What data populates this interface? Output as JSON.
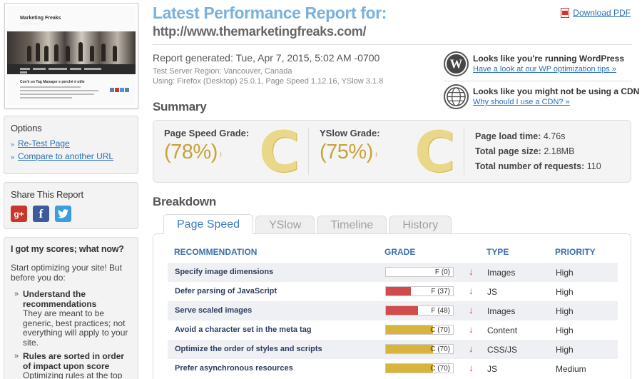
{
  "thumbnail": {
    "site_title": "Marketing Freaks",
    "post_title": "Cos'è un Tag Manager e perché è utile"
  },
  "options": {
    "heading": "Options",
    "items": [
      {
        "label": "Re-Test Page"
      },
      {
        "label": "Compare to another URL"
      }
    ]
  },
  "share": {
    "heading": "Share This Report",
    "icons": [
      "google-plus-icon",
      "facebook-icon",
      "twitter-icon"
    ]
  },
  "scores": {
    "heading": "I got my scores; what now?",
    "intro": "Start optimizing your site! But before you do:",
    "tips": [
      {
        "title": "Understand the recommendations",
        "text": "They are meant to be generic, best practices; not everything will apply to your site."
      },
      {
        "title": "Rules are sorted in order of impact upon score",
        "text": "Optimizing rules at the top of"
      }
    ]
  },
  "header": {
    "title": "Latest Performance Report for:",
    "url": "http://www.themarketingfreaks.com/",
    "download_label": "Download PDF"
  },
  "report": {
    "generated": "Report generated: Tue, Apr 7, 2015, 5:02 AM -0700",
    "region": "Test Server Region: Vancouver, Canada",
    "using": "Using: Firefox (Desktop) 25.0.1, Page Speed 1.12.16, YSlow 3.1.8"
  },
  "notices": [
    {
      "title": "Looks like you're running WordPress",
      "link": "Have a look at our WP optimization tips »",
      "icon": "wordpress-icon"
    },
    {
      "title": "Looks like you might not be using a CDN",
      "link": "Why should I use a CDN? »",
      "icon": "globe-icon"
    }
  ],
  "summary": {
    "heading": "Summary",
    "pagespeed": {
      "label": "Page Speed Grade:",
      "pct": "(78%)",
      "letter": "C"
    },
    "yslow": {
      "label": "YSlow Grade:",
      "pct": "(75%)",
      "letter": "C"
    },
    "stats": {
      "load_label": "Page load time:",
      "load_value": "4.76s",
      "size_label": "Total page size:",
      "size_value": "2.18MB",
      "req_label": "Total number of requests:",
      "req_value": "110"
    },
    "colors": {
      "grade_c": "#c8a23a"
    }
  },
  "breakdown": {
    "heading": "Breakdown",
    "tabs": [
      {
        "label": "Page Speed",
        "active": true
      },
      {
        "label": "YSlow",
        "active": false
      },
      {
        "label": "Timeline",
        "active": false
      },
      {
        "label": "History",
        "active": false
      }
    ],
    "columns": {
      "recommendation": "RECOMMENDATION",
      "grade": "GRADE",
      "type": "TYPE",
      "priority": "PRIORITY"
    },
    "rows": [
      {
        "recommendation": "Specify image dimensions",
        "grade": "F (0)",
        "score": 0,
        "color": "#d24b4b",
        "type": "Images",
        "priority": "High"
      },
      {
        "recommendation": "Defer parsing of JavaScript",
        "grade": "F (37)",
        "score": 37,
        "color": "#d24b4b",
        "type": "JS",
        "priority": "High"
      },
      {
        "recommendation": "Serve scaled images",
        "grade": "F (48)",
        "score": 48,
        "color": "#d24b4b",
        "type": "Images",
        "priority": "High"
      },
      {
        "recommendation": "Avoid a character set in the meta tag",
        "grade": "C (70)",
        "score": 70,
        "color": "#d9b43c",
        "type": "Content",
        "priority": "High"
      },
      {
        "recommendation": "Optimize the order of styles and scripts",
        "grade": "C (70)",
        "score": 70,
        "color": "#d9b43c",
        "type": "CSS/JS",
        "priority": "High"
      },
      {
        "recommendation": "Prefer asynchronous resources",
        "grade": "C (70)",
        "score": 70,
        "color": "#d9b43c",
        "type": "JS",
        "priority": "Medium"
      }
    ]
  }
}
